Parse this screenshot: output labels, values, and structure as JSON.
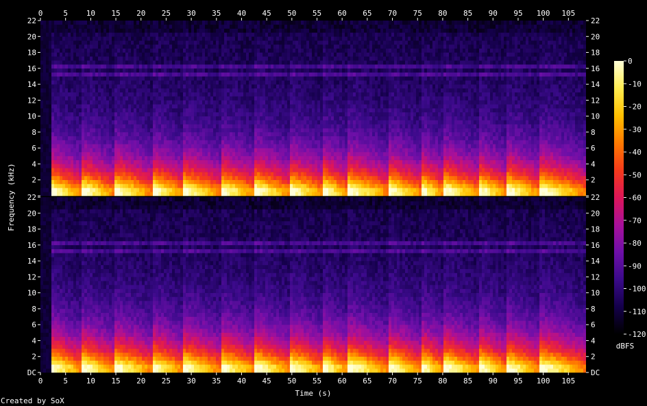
{
  "chart_data": {
    "type": "heatmap",
    "title": "",
    "xlabel": "Time (s)",
    "ylabel": "Frequency (kHz)",
    "xlim": [
      0,
      108.5
    ],
    "ylim": [
      0,
      22
    ],
    "x_ticks": [
      0,
      5,
      10,
      15,
      20,
      25,
      30,
      35,
      40,
      45,
      50,
      55,
      60,
      65,
      70,
      75,
      80,
      85,
      90,
      95,
      100,
      105
    ],
    "y_ticks": [
      0,
      2,
      4,
      6,
      8,
      10,
      12,
      14,
      16,
      18,
      20,
      22
    ],
    "y_tick_labels_top": [
      "",
      "2",
      "4",
      "6",
      "8",
      "10",
      "12",
      "14",
      "16",
      "18",
      "20",
      "22"
    ],
    "y_tick_labels_bottom": [
      "DC",
      "2",
      "4",
      "6",
      "8",
      "10",
      "12",
      "14",
      "16",
      "18",
      "20",
      "22"
    ],
    "channels": 2,
    "colorbar": {
      "label": "dBFS",
      "range": [
        -120,
        0
      ],
      "ticks": [
        0,
        -10,
        -20,
        -30,
        -40,
        -50,
        -60,
        -70,
        -80,
        -90,
        -100,
        -110,
        -120
      ],
      "colors": [
        "#000000",
        "#14004a",
        "#3a0a8a",
        "#6e0fa8",
        "#a8109a",
        "#dd1658",
        "#f53a1a",
        "#ff7a00",
        "#ffbf00",
        "#ffec50",
        "#ffffd8"
      ]
    },
    "segments_s": [
      [
        2,
        8
      ],
      [
        8,
        14.5
      ],
      [
        14.5,
        22
      ],
      [
        22,
        28
      ],
      [
        28,
        35.5
      ],
      [
        35.5,
        42.5
      ],
      [
        42.5,
        49.5
      ],
      [
        49.5,
        56
      ],
      [
        56,
        61
      ],
      [
        61,
        69
      ],
      [
        69,
        75.5
      ],
      [
        75.5,
        80
      ],
      [
        80,
        87
      ],
      [
        87,
        92.5
      ],
      [
        92.5,
        99
      ],
      [
        99,
        108
      ]
    ],
    "features": {
      "energy_concentration_khz": [
        0,
        3
      ],
      "bands_khz": [
        15,
        16
      ],
      "upper_cutoff_khz": 20
    }
  },
  "footer": {
    "credit": "Created by SoX"
  }
}
